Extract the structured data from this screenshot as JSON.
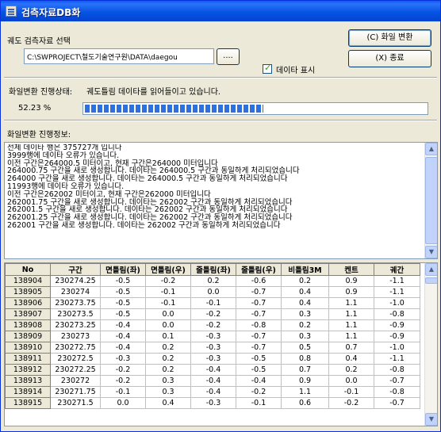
{
  "window": {
    "title": "검측자료DB화"
  },
  "select": {
    "label": "궤도 검측자료 선택",
    "path": "C:\\SWPROJECT\\철도기술연구원\\DATA\\daegou",
    "browse_label": "...."
  },
  "buttons": {
    "convert": "(C) 화일 변환",
    "exit": "(X) 종료"
  },
  "show_data": {
    "label": "데이타 표시",
    "checked": true
  },
  "progress": {
    "status_label": "화일변환 진행상태:",
    "status_text": "궤도틀림 데이타를 읽어들이고 있습니다.",
    "percent_text": "52.23 %",
    "percent": 52.23
  },
  "log": {
    "label": "화일변환 진행정보:",
    "lines": [
      "전체 데이타 행은 375727개 입니다",
      "3999행에 데이타 오류가 있습니다.",
      "이전 구간은264000.5 미터이고, 현재 구간은264000 미터입니다",
      "264000.75 구간을 새로 생성합니다. 데이타는 264000.5 구간과 동일하게 처리되었습니다",
      "264000 구간을 새로 생성합니다. 데이타는 264000.5 구간과 동일하게 처리되었습니다",
      "11993행에 데이타 오류가 있습니다.",
      "이전 구간은262002 미터이고, 현재 구간은262000 미터입니다",
      "262001.75 구간을 새로 생성합니다. 데이타는 262002 구간과 동일하게 처리되었습니다",
      "262001.5 구간을 새로 생성합니다. 데이타는 262002 구간과 동일하게 처리되었습니다",
      "262001.25 구간을 새로 생성합니다. 데이타는 262002 구간과 동일하게 처리되었습니다",
      "262001 구간을 새로 생성합니다. 데이타는 262002 구간과 동일하게 처리되었습니다"
    ]
  },
  "table": {
    "columns": [
      "No",
      "구간",
      "면틀림(좌)",
      "면틀림(우)",
      "줄틀림(좌)",
      "줄틀림(우)",
      "비틀림3M",
      "켄트",
      "궤간"
    ],
    "rows": [
      [
        "138904",
        "230274.25",
        "-0.5",
        "-0.2",
        "0.2",
        "-0.6",
        "0.2",
        "0.9",
        "-1.1"
      ],
      [
        "138905",
        "230274",
        "-0.5",
        "-0.1",
        "0.0",
        "-0.7",
        "0.4",
        "0.9",
        "-1.1"
      ],
      [
        "138906",
        "230273.75",
        "-0.5",
        "-0.1",
        "-0.1",
        "-0.7",
        "0.4",
        "1.1",
        "-1.0"
      ],
      [
        "138907",
        "230273.5",
        "-0.5",
        "0.0",
        "-0.2",
        "-0.7",
        "0.3",
        "1.1",
        "-0.8"
      ],
      [
        "138908",
        "230273.25",
        "-0.4",
        "0.0",
        "-0.2",
        "-0.8",
        "0.2",
        "1.1",
        "-0.9"
      ],
      [
        "138909",
        "230273",
        "-0.4",
        "0.1",
        "-0.3",
        "-0.7",
        "0.3",
        "1.1",
        "-0.9"
      ],
      [
        "138910",
        "230272.75",
        "-0.4",
        "0.2",
        "-0.3",
        "-0.7",
        "0.5",
        "0.7",
        "-1.0"
      ],
      [
        "138911",
        "230272.5",
        "-0.3",
        "0.2",
        "-0.3",
        "-0.5",
        "0.8",
        "0.4",
        "-1.1"
      ],
      [
        "138912",
        "230272.25",
        "-0.2",
        "0.2",
        "-0.4",
        "-0.5",
        "0.7",
        "0.2",
        "-0.8"
      ],
      [
        "138913",
        "230272",
        "-0.2",
        "0.3",
        "-0.4",
        "-0.4",
        "0.9",
        "0.0",
        "-0.7"
      ],
      [
        "138914",
        "230271.75",
        "-0.1",
        "0.3",
        "-0.4",
        "-0.2",
        "1.1",
        "-0.1",
        "-0.8"
      ],
      [
        "138915",
        "230271.5",
        "0.0",
        "0.4",
        "-0.3",
        "-0.1",
        "0.6",
        "-0.2",
        "-0.7"
      ]
    ]
  }
}
